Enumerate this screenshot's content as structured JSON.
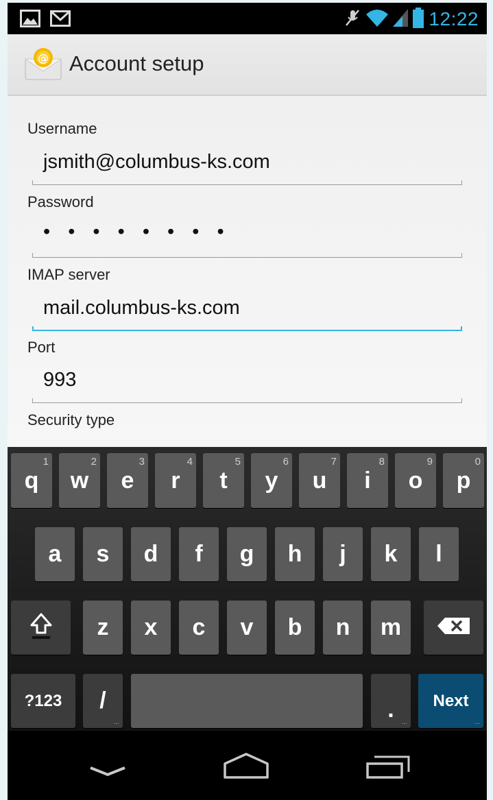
{
  "status_bar": {
    "time": "12:22",
    "left_icons": [
      "gallery-icon",
      "gmail-icon"
    ],
    "right_icons": [
      "mute-icon",
      "wifi-icon",
      "signal-icon",
      "battery-icon"
    ],
    "accent_color": "#33b5e5"
  },
  "action_bar": {
    "title": "Account setup",
    "icon": "email-envelope-icon"
  },
  "form": {
    "username_label": "Username",
    "username_value": "jsmith@columbus-ks.com",
    "password_label": "Password",
    "password_value": "• • • • • • • •",
    "imap_label": "IMAP server",
    "imap_value": "mail.columbus-ks.com",
    "port_label": "Port",
    "port_value": "993",
    "security_label": "Security type",
    "focus_color": "#33b5e5"
  },
  "keyboard": {
    "row1": [
      {
        "key": "q",
        "hint": "1"
      },
      {
        "key": "w",
        "hint": "2"
      },
      {
        "key": "e",
        "hint": "3"
      },
      {
        "key": "r",
        "hint": "4"
      },
      {
        "key": "t",
        "hint": "5"
      },
      {
        "key": "y",
        "hint": "6"
      },
      {
        "key": "u",
        "hint": "7"
      },
      {
        "key": "i",
        "hint": "8"
      },
      {
        "key": "o",
        "hint": "9"
      },
      {
        "key": "p",
        "hint": "0"
      }
    ],
    "row2": [
      "a",
      "s",
      "d",
      "f",
      "g",
      "h",
      "j",
      "k",
      "l"
    ],
    "row3": [
      "z",
      "x",
      "c",
      "v",
      "b",
      "n",
      "m"
    ],
    "symbols_label": "?123",
    "slash_label": "/",
    "period_label": ".",
    "next_label": "Next",
    "next_color": "#0b4c72"
  },
  "nav_bar": {
    "buttons": [
      "back-icon",
      "home-icon",
      "recent-apps-icon"
    ]
  }
}
